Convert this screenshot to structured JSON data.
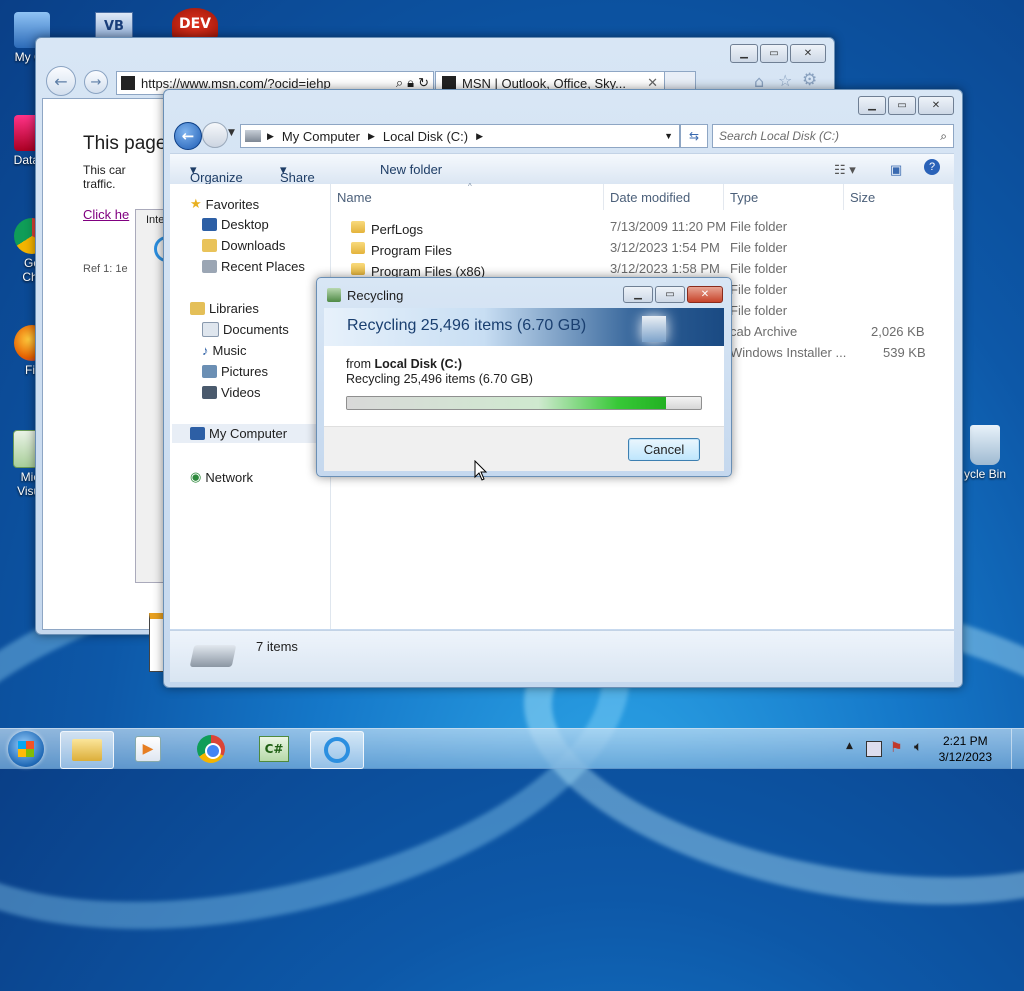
{
  "desktop": {
    "icons": [
      {
        "label": "My Co"
      },
      {
        "label": "DataW"
      },
      {
        "label": "Go"
      },
      {
        "label": "Chr"
      },
      {
        "label": "Fir"
      },
      {
        "label": "Micr"
      },
      {
        "label": "Visua"
      },
      {
        "label": "ycle Bin"
      }
    ],
    "top_icons": [
      {
        "label": "VB"
      },
      {
        "label": "DEV"
      }
    ]
  },
  "ie": {
    "url": "https://www.msn.com/?ocid=iehp",
    "tab_title": "MSN | Outlook, Office, Sky...",
    "heading": "This page",
    "body_text": "This car traffic.",
    "link_text": "Click he",
    "ref_text": "Ref 1: 1e",
    "ghost_label": "Inter"
  },
  "explorer": {
    "breadcrumb": [
      "My Computer",
      "Local Disk (C:)"
    ],
    "search_placeholder": "Search Local Disk (C:)",
    "toolbar": {
      "organize": "Organize",
      "share": "Share with",
      "new_folder": "New folder"
    },
    "nav": {
      "favorites": "Favorites",
      "desktop": "Desktop",
      "downloads": "Downloads",
      "recent": "Recent Places",
      "libraries": "Libraries",
      "documents": "Documents",
      "music": "Music",
      "pictures": "Pictures",
      "videos": "Videos",
      "mycomputer": "My Computer",
      "network": "Network"
    },
    "columns": {
      "name": "Name",
      "date": "Date modified",
      "type": "Type",
      "size": "Size"
    },
    "rows": [
      {
        "name": "PerfLogs",
        "date": "7/13/2009 11:20 PM",
        "type": "File folder",
        "size": ""
      },
      {
        "name": "Program Files",
        "date": "3/12/2023 1:54 PM",
        "type": "File folder",
        "size": ""
      },
      {
        "name": "Program Files (x86)",
        "date": "3/12/2023 1:58 PM",
        "type": "File folder",
        "size": ""
      },
      {
        "name": "",
        "date": "",
        "type": "File folder",
        "size": ""
      },
      {
        "name": "",
        "date": "",
        "type": "File folder",
        "size": ""
      },
      {
        "name": "",
        "date": "",
        "type": "cab Archive",
        "size": "2,026 KB"
      },
      {
        "name": "",
        "date": "",
        "type": "Windows Installer ...",
        "size": "539 KB"
      }
    ],
    "status": "7 items"
  },
  "dialog": {
    "title": "Recycling",
    "banner": "Recycling 25,496 items (6.70 GB)",
    "from_label": "from",
    "from_value": "Local Disk (C:)",
    "detail": "Recycling 25,496 items (6.70 GB)",
    "progress": 0.9,
    "cancel": "Cancel"
  },
  "taskbar": {
    "time": "2:21 PM",
    "date": "3/12/2023"
  }
}
